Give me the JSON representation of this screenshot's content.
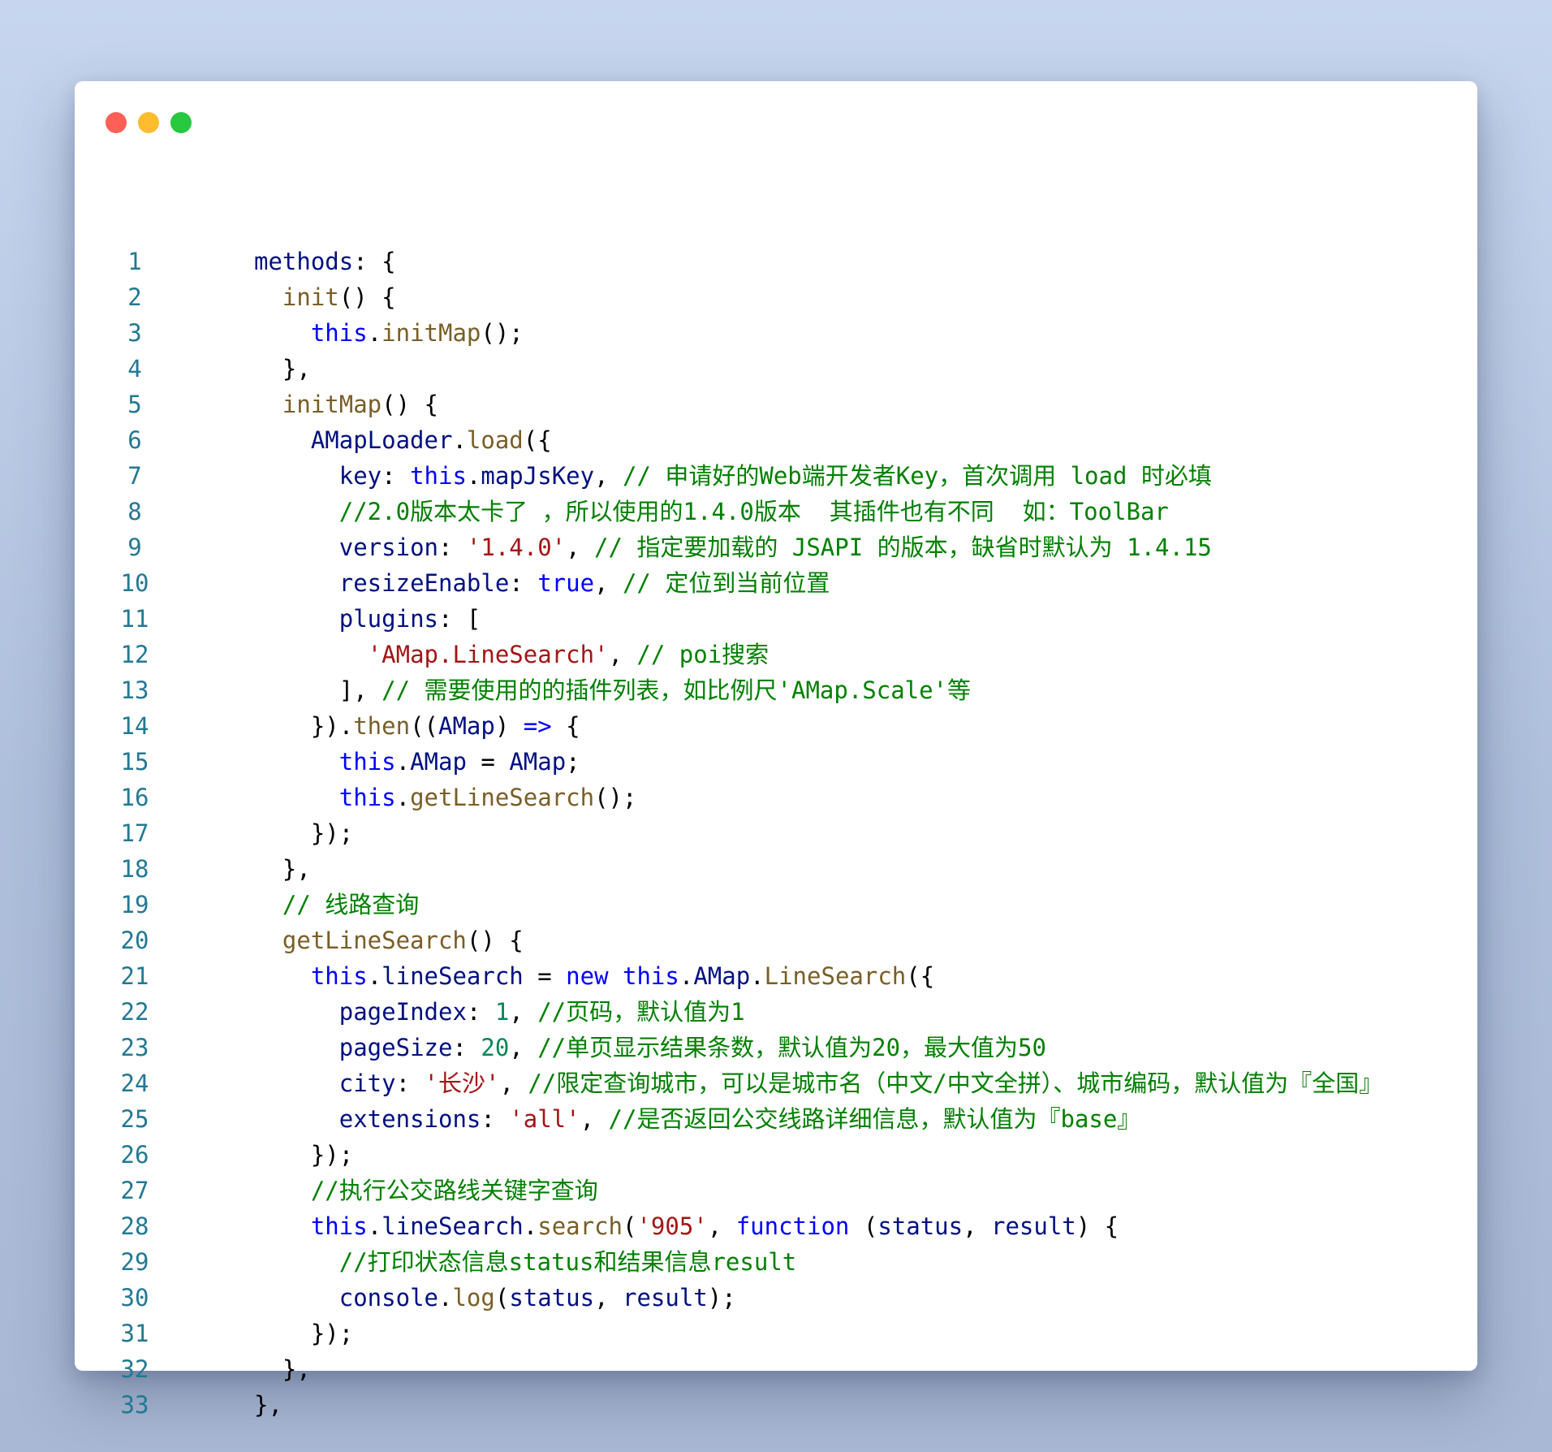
{
  "window": {
    "controls": [
      {
        "name": "close",
        "color": "#fe5f57"
      },
      {
        "name": "minimize",
        "color": "#febc2e"
      },
      {
        "name": "maximize",
        "color": "#28c840"
      }
    ]
  },
  "colors": {
    "line_number": "#237893",
    "plain": "#000000",
    "property": "#001080",
    "function": "#795e26",
    "keyword": "#0000ff",
    "string": "#a31515",
    "number": "#098658",
    "comment": "#008000",
    "type": "#267f99"
  },
  "code": {
    "lines": [
      {
        "n": "1",
        "tokens": [
          [
            "pr",
            "methods"
          ],
          [
            "pl",
            ": {"
          ]
        ]
      },
      {
        "n": "2",
        "tokens": [
          [
            "pl",
            "  "
          ],
          [
            "fn",
            "init"
          ],
          [
            "pl",
            "() {"
          ]
        ]
      },
      {
        "n": "3",
        "tokens": [
          [
            "pl",
            "    "
          ],
          [
            "kw",
            "this"
          ],
          [
            "pl",
            "."
          ],
          [
            "fn",
            "initMap"
          ],
          [
            "pl",
            "();"
          ]
        ]
      },
      {
        "n": "4",
        "tokens": [
          [
            "pl",
            "  },"
          ]
        ]
      },
      {
        "n": "5",
        "tokens": [
          [
            "pl",
            "  "
          ],
          [
            "fn",
            "initMap"
          ],
          [
            "pl",
            "() {"
          ]
        ]
      },
      {
        "n": "6",
        "tokens": [
          [
            "pl",
            "    "
          ],
          [
            "pr",
            "AMapLoader"
          ],
          [
            "pl",
            "."
          ],
          [
            "fn",
            "load"
          ],
          [
            "pl",
            "({"
          ]
        ]
      },
      {
        "n": "7",
        "tokens": [
          [
            "pl",
            "      "
          ],
          [
            "pr",
            "key"
          ],
          [
            "pl",
            ": "
          ],
          [
            "kw",
            "this"
          ],
          [
            "pl",
            "."
          ],
          [
            "pr",
            "mapJsKey"
          ],
          [
            "pl",
            ", "
          ],
          [
            "cm",
            "// 申请好的Web端开发者Key，首次调用 load 时必填"
          ]
        ]
      },
      {
        "n": "8",
        "tokens": [
          [
            "pl",
            "      "
          ],
          [
            "cm",
            "//2.0版本太卡了 ，所以使用的1.4.0版本  其插件也有不同  如：ToolBar"
          ]
        ]
      },
      {
        "n": "9",
        "tokens": [
          [
            "pl",
            "      "
          ],
          [
            "pr",
            "version"
          ],
          [
            "pl",
            ": "
          ],
          [
            "st",
            "'1.4.0'"
          ],
          [
            "pl",
            ", "
          ],
          [
            "cm",
            "// 指定要加载的 JSAPI 的版本，缺省时默认为 1.4.15"
          ]
        ]
      },
      {
        "n": "10",
        "tokens": [
          [
            "pl",
            "      "
          ],
          [
            "pr",
            "resizeEnable"
          ],
          [
            "pl",
            ": "
          ],
          [
            "kw",
            "true"
          ],
          [
            "pl",
            ", "
          ],
          [
            "cm",
            "// 定位到当前位置"
          ]
        ]
      },
      {
        "n": "11",
        "tokens": [
          [
            "pl",
            "      "
          ],
          [
            "pr",
            "plugins"
          ],
          [
            "pl",
            ": ["
          ]
        ]
      },
      {
        "n": "12",
        "tokens": [
          [
            "pl",
            "        "
          ],
          [
            "st",
            "'AMap.LineSearch'"
          ],
          [
            "pl",
            ", "
          ],
          [
            "cm",
            "// poi搜索"
          ]
        ]
      },
      {
        "n": "13",
        "tokens": [
          [
            "pl",
            "      ], "
          ],
          [
            "cm",
            "// 需要使用的的插件列表，如比例尺'AMap.Scale'等"
          ]
        ]
      },
      {
        "n": "14",
        "tokens": [
          [
            "pl",
            "    })."
          ],
          [
            "fn",
            "then"
          ],
          [
            "pl",
            "(("
          ],
          [
            "pr",
            "AMap"
          ],
          [
            "pl",
            ") "
          ],
          [
            "kw",
            "=>"
          ],
          [
            "pl",
            " {"
          ]
        ]
      },
      {
        "n": "15",
        "tokens": [
          [
            "pl",
            "      "
          ],
          [
            "kw",
            "this"
          ],
          [
            "pl",
            "."
          ],
          [
            "pr",
            "AMap"
          ],
          [
            "pl",
            " = "
          ],
          [
            "pr",
            "AMap"
          ],
          [
            "pl",
            ";"
          ]
        ]
      },
      {
        "n": "16",
        "tokens": [
          [
            "pl",
            "      "
          ],
          [
            "kw",
            "this"
          ],
          [
            "pl",
            "."
          ],
          [
            "fn",
            "getLineSearch"
          ],
          [
            "pl",
            "();"
          ]
        ]
      },
      {
        "n": "17",
        "tokens": [
          [
            "pl",
            "    });"
          ]
        ]
      },
      {
        "n": "18",
        "tokens": [
          [
            "pl",
            "  },"
          ]
        ]
      },
      {
        "n": "19",
        "tokens": [
          [
            "pl",
            "  "
          ],
          [
            "cm",
            "// 线路查询"
          ]
        ]
      },
      {
        "n": "20",
        "tokens": [
          [
            "pl",
            "  "
          ],
          [
            "fn",
            "getLineSearch"
          ],
          [
            "pl",
            "() {"
          ]
        ]
      },
      {
        "n": "21",
        "tokens": [
          [
            "pl",
            "    "
          ],
          [
            "kw",
            "this"
          ],
          [
            "pl",
            "."
          ],
          [
            "pr",
            "lineSearch"
          ],
          [
            "pl",
            " = "
          ],
          [
            "kw",
            "new"
          ],
          [
            "pl",
            " "
          ],
          [
            "kw",
            "this"
          ],
          [
            "pl",
            "."
          ],
          [
            "pr",
            "AMap"
          ],
          [
            "pl",
            "."
          ],
          [
            "fn",
            "LineSearch"
          ],
          [
            "pl",
            "({"
          ]
        ]
      },
      {
        "n": "22",
        "tokens": [
          [
            "pl",
            "      "
          ],
          [
            "pr",
            "pageIndex"
          ],
          [
            "pl",
            ": "
          ],
          [
            "nm",
            "1"
          ],
          [
            "pl",
            ", "
          ],
          [
            "cm",
            "//页码，默认值为1"
          ]
        ]
      },
      {
        "n": "23",
        "tokens": [
          [
            "pl",
            "      "
          ],
          [
            "pr",
            "pageSize"
          ],
          [
            "pl",
            ": "
          ],
          [
            "nm",
            "20"
          ],
          [
            "pl",
            ", "
          ],
          [
            "cm",
            "//单页显示结果条数，默认值为20，最大值为50"
          ]
        ]
      },
      {
        "n": "24",
        "tokens": [
          [
            "pl",
            "      "
          ],
          [
            "pr",
            "city"
          ],
          [
            "pl",
            ": "
          ],
          [
            "st",
            "'长沙'"
          ],
          [
            "pl",
            ", "
          ],
          [
            "cm",
            "//限定查询城市，可以是城市名（中文/中文全拼）、城市编码，默认值为『全国』"
          ]
        ]
      },
      {
        "n": "25",
        "tokens": [
          [
            "pl",
            "      "
          ],
          [
            "pr",
            "extensions"
          ],
          [
            "pl",
            ": "
          ],
          [
            "st",
            "'all'"
          ],
          [
            "pl",
            ", "
          ],
          [
            "cm",
            "//是否返回公交线路详细信息，默认值为『base』"
          ]
        ]
      },
      {
        "n": "26",
        "tokens": [
          [
            "pl",
            "    });"
          ]
        ]
      },
      {
        "n": "27",
        "tokens": [
          [
            "pl",
            "    "
          ],
          [
            "cm",
            "//执行公交路线关键字查询"
          ]
        ]
      },
      {
        "n": "28",
        "tokens": [
          [
            "pl",
            "    "
          ],
          [
            "kw",
            "this"
          ],
          [
            "pl",
            "."
          ],
          [
            "pr",
            "lineSearch"
          ],
          [
            "pl",
            "."
          ],
          [
            "fn",
            "search"
          ],
          [
            "pl",
            "("
          ],
          [
            "st",
            "'905'"
          ],
          [
            "pl",
            ", "
          ],
          [
            "kw",
            "function"
          ],
          [
            "pl",
            " ("
          ],
          [
            "pr",
            "status"
          ],
          [
            "pl",
            ", "
          ],
          [
            "pr",
            "result"
          ],
          [
            "pl",
            ") {"
          ]
        ]
      },
      {
        "n": "29",
        "tokens": [
          [
            "pl",
            "      "
          ],
          [
            "cm",
            "//打印状态信息status和结果信息result"
          ]
        ]
      },
      {
        "n": "30",
        "tokens": [
          [
            "pl",
            "      "
          ],
          [
            "pr",
            "console"
          ],
          [
            "pl",
            "."
          ],
          [
            "fn",
            "log"
          ],
          [
            "pl",
            "("
          ],
          [
            "pr",
            "status"
          ],
          [
            "pl",
            ", "
          ],
          [
            "pr",
            "result"
          ],
          [
            "pl",
            ");"
          ]
        ]
      },
      {
        "n": "31",
        "tokens": [
          [
            "pl",
            "    });"
          ]
        ]
      },
      {
        "n": "32",
        "tokens": [
          [
            "pl",
            "  },"
          ]
        ]
      },
      {
        "n": "33",
        "tokens": [
          [
            "pl",
            "},"
          ]
        ]
      }
    ]
  }
}
